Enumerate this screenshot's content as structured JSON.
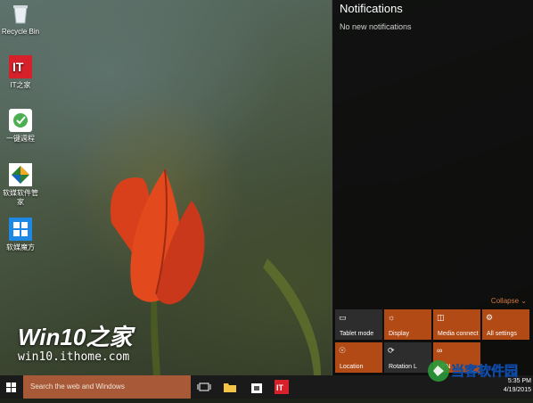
{
  "desktop": {
    "icons": [
      {
        "label": "Recycle Bin",
        "icon": "recycle-bin-icon"
      },
      {
        "label": "IT之家",
        "icon": "it-home-icon"
      },
      {
        "label": "一键週程",
        "icon": "one-key-tool-icon"
      },
      {
        "label": "软媒软件管家",
        "icon": "software-manager-icon"
      },
      {
        "label": "软媒魔方",
        "icon": "rubiks-cube-icon"
      }
    ],
    "watermark": {
      "title": "Win10之家",
      "subtitle": "win10.ithome.com"
    }
  },
  "action_center": {
    "title": "Notifications",
    "empty_text": "No new notifications",
    "collapse_label": "Collapse",
    "tiles": [
      {
        "label": "Tablet mode",
        "icon": "tablet-mode-icon",
        "active": false
      },
      {
        "label": "Display",
        "icon": "display-icon",
        "active": true
      },
      {
        "label": "Media connect",
        "icon": "media-connect-icon",
        "active": true
      },
      {
        "label": "All settings",
        "icon": "gear-icon",
        "active": true
      },
      {
        "label": "Location",
        "icon": "location-icon",
        "active": true
      },
      {
        "label": "Rotation L",
        "icon": "rotation-lock-icon",
        "active": false
      },
      {
        "label": "VPN",
        "icon": "vpn-icon",
        "active": true
      }
    ]
  },
  "taskbar": {
    "search_placeholder": "Search the web and Windows",
    "clock_time": "5:35 PM",
    "clock_date": "4/19/2015"
  },
  "colors": {
    "accent": "#b24a16",
    "search_bg": "#a85a38",
    "panel_bg": "#0c0c0c"
  }
}
